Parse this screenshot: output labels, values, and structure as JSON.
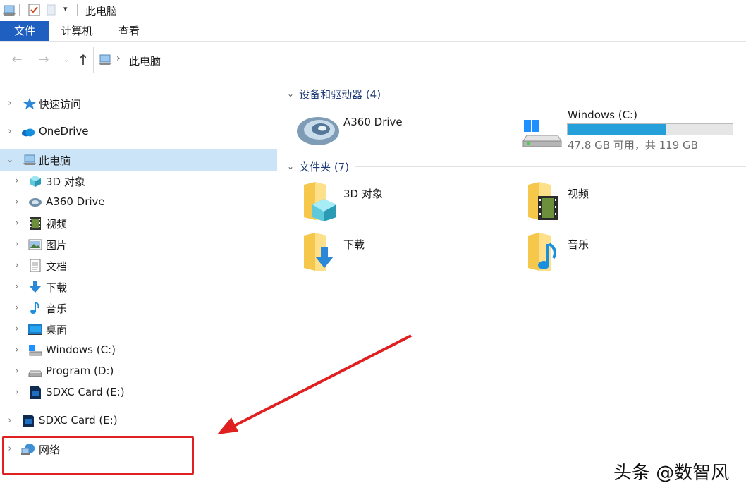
{
  "window": {
    "title": "此电脑"
  },
  "ribbon": {
    "tabs": [
      {
        "label": "文件"
      },
      {
        "label": "计算机"
      },
      {
        "label": "查看"
      }
    ]
  },
  "address": {
    "path": "此电脑"
  },
  "nav": {
    "quick_access": "快速访问",
    "onedrive": "OneDrive",
    "this_pc": "此电脑",
    "this_pc_children": [
      {
        "label": "3D 对象",
        "icon": "3d-objects-icon"
      },
      {
        "label": "A360 Drive",
        "icon": "a360-drive-icon"
      },
      {
        "label": "视频",
        "icon": "video-icon"
      },
      {
        "label": "图片",
        "icon": "pictures-icon"
      },
      {
        "label": "文档",
        "icon": "documents-icon"
      },
      {
        "label": "下载",
        "icon": "download-icon"
      },
      {
        "label": "音乐",
        "icon": "music-icon"
      },
      {
        "label": "桌面",
        "icon": "desktop-icon"
      },
      {
        "label": "Windows (C:)",
        "icon": "windows-drive-icon"
      },
      {
        "label": "Program (D:)",
        "icon": "drive-icon"
      },
      {
        "label": "SDXC Card (E:)",
        "icon": "sd-card-icon"
      }
    ],
    "sdxc": "SDXC Card (E:)",
    "network": "网络"
  },
  "content": {
    "devices_header": "设备和驱动器 (4)",
    "devices": [
      {
        "name": "A360 Drive",
        "icon": "a360-drive-icon"
      },
      {
        "name": "Windows (C:)",
        "icon": "windows-drive-icon",
        "used_fraction": 0.6,
        "space": "47.8 GB 可用，共 119 GB"
      }
    ],
    "folders_header": "文件夹 (7)",
    "folders": [
      {
        "name": "3D 对象",
        "icon": "3d-objects-folder-icon"
      },
      {
        "name": "视频",
        "icon": "video-folder-icon"
      },
      {
        "name": "下载",
        "icon": "download-folder-icon"
      },
      {
        "name": "音乐",
        "icon": "music-folder-icon"
      }
    ]
  },
  "watermark": "头条 @数智风",
  "colors": {
    "accent": "#1e5fbf",
    "selection": "#cce4f7",
    "bar": "#26a0da",
    "highlight": "#e02020"
  }
}
